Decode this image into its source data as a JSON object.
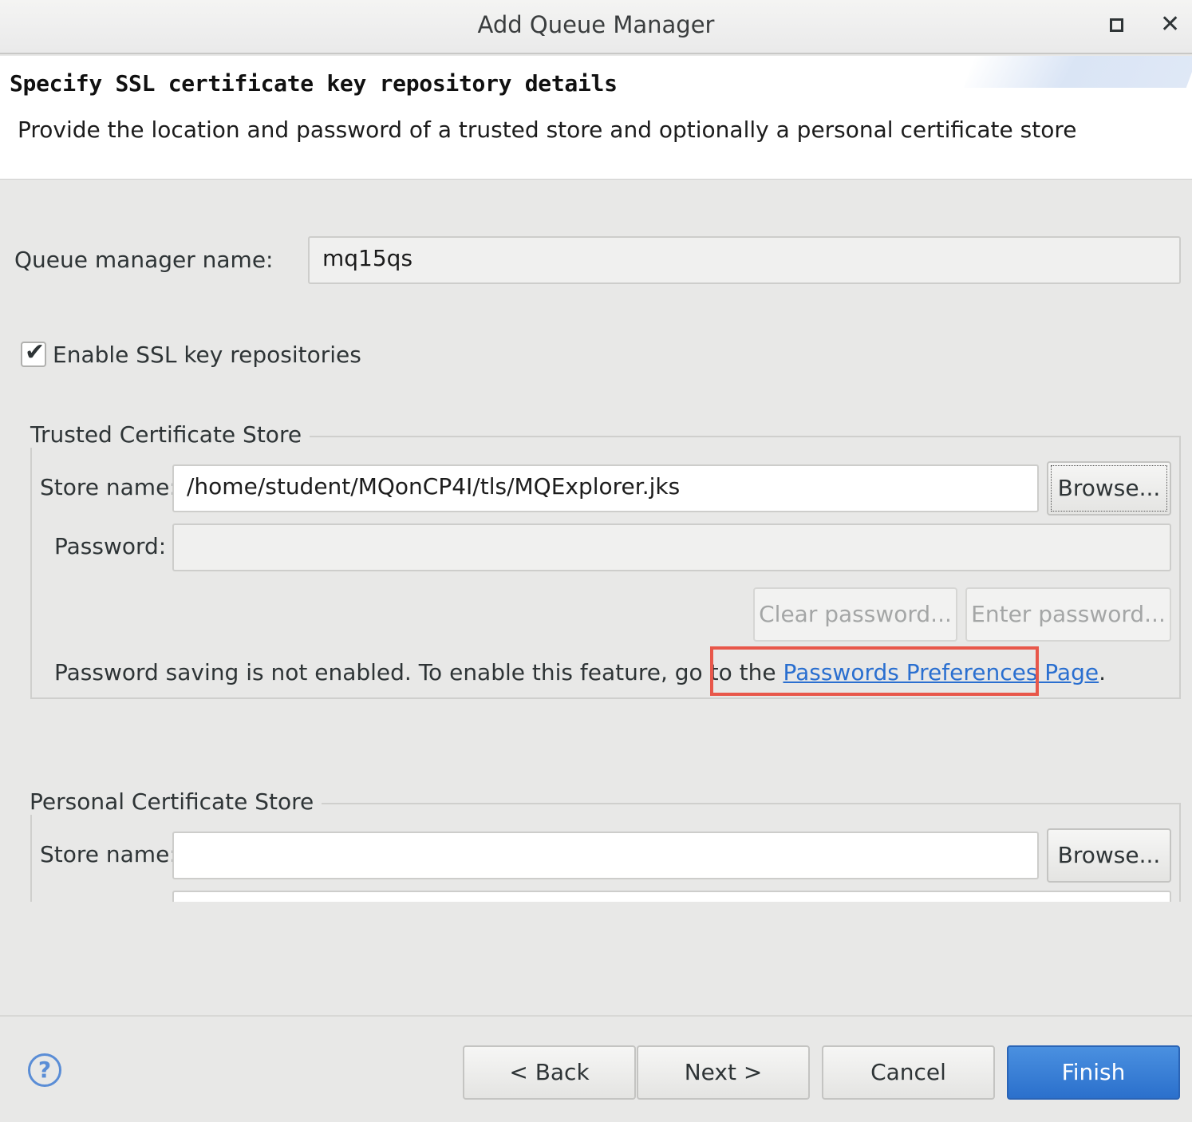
{
  "window": {
    "title": "Add Queue Manager"
  },
  "header": {
    "title": "Specify SSL certificate key repository details",
    "description": "Provide the location and password of a trusted store and optionally a personal certificate store"
  },
  "queue_manager": {
    "label": "Queue manager name:",
    "value": "mq15qs"
  },
  "enable_ssl": {
    "label": "Enable SSL key repositories",
    "checked": true
  },
  "trusted_store": {
    "title": "Trusted Certificate Store",
    "store_label": "Store name:",
    "store_value": "/home/student/MQonCP4I/tls/MQExplorer.jks",
    "browse_label": "Browse...",
    "password_label": "Password:",
    "password_value": "",
    "clear_password_label": "Clear password...",
    "enter_password_label": "Enter password...",
    "notice_text": "Password saving is not enabled.  To enable this feature, go to the ",
    "notice_link": "Passwords Preferences Page",
    "notice_end": "."
  },
  "personal_store": {
    "title": "Personal Certificate Store",
    "store_label": "Store name:",
    "store_value": "",
    "browse_label": "Browse..."
  },
  "footer": {
    "back_label": "< Back",
    "next_label": "Next >",
    "cancel_label": "Cancel",
    "finish_label": "Finish"
  },
  "icons": {
    "help": "help-icon",
    "maximize": "maximize-icon",
    "close": "close-icon",
    "check": "check-icon"
  },
  "colors": {
    "finish_button": "#2b70cc",
    "link": "#2a6fd0",
    "highlight": "#e8574a"
  }
}
